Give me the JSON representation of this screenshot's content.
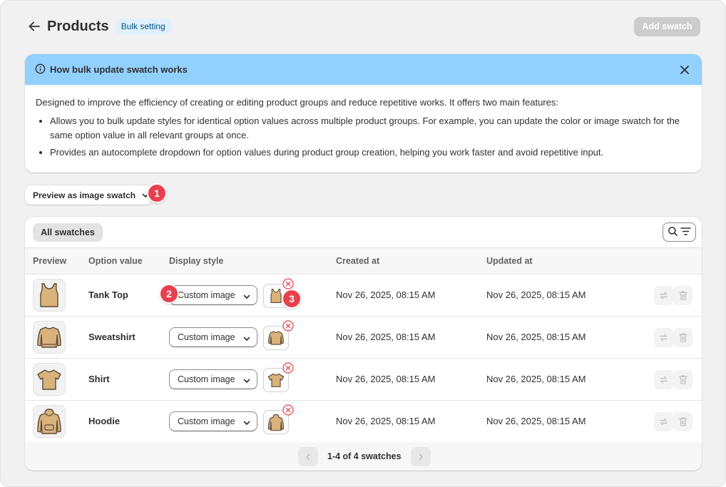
{
  "header": {
    "title": "Products",
    "badge": "Bulk setting",
    "add_swatch_label": "Add swatch"
  },
  "banner": {
    "title": "How bulk update swatch works",
    "intro": "Designed to improve the efficiency of creating or editing product groups and reduce repetitive works. It offers two main features:",
    "bullets": [
      "Allows you to bulk update styles for identical option values across multiple product groups. For example, you can update the color or image swatch for the same option value in all relevant groups at once.",
      "Provides an autocomplete dropdown for option values during product group creation, helping you work faster and avoid repetitive input."
    ],
    "bg_color": "#91d0ff"
  },
  "preview_select": {
    "label": "Preview as image swatch"
  },
  "steps": [
    "1",
    "2",
    "3"
  ],
  "step_color": "#e8404e",
  "card": {
    "tab_all": "All swatches",
    "columns": {
      "preview": "Preview",
      "option_value": "Option value",
      "display_style": "Display style",
      "created_at": "Created at",
      "updated_at": "Updated at"
    },
    "rows": [
      {
        "icon": "tank-top-icon",
        "option_value": "Tank Top",
        "display_style": "Custom image",
        "created_at": "Nov 26, 2025, 08:15 AM",
        "updated_at": "Nov 26, 2025, 08:15 AM"
      },
      {
        "icon": "sweatshirt-icon",
        "option_value": "Sweatshirt",
        "display_style": "Custom image",
        "created_at": "Nov 26, 2025, 08:15 AM",
        "updated_at": "Nov 26, 2025, 08:15 AM"
      },
      {
        "icon": "shirt-icon",
        "option_value": "Shirt",
        "display_style": "Custom image",
        "created_at": "Nov 26, 2025, 08:15 AM",
        "updated_at": "Nov 26, 2025, 08:15 AM"
      },
      {
        "icon": "hoodie-icon",
        "option_value": "Hoodie",
        "display_style": "Custom image",
        "created_at": "Nov 26, 2025, 08:15 AM",
        "updated_at": "Nov 26, 2025, 08:15 AM"
      }
    ],
    "pagination": "1-4 of 4 swatches"
  }
}
